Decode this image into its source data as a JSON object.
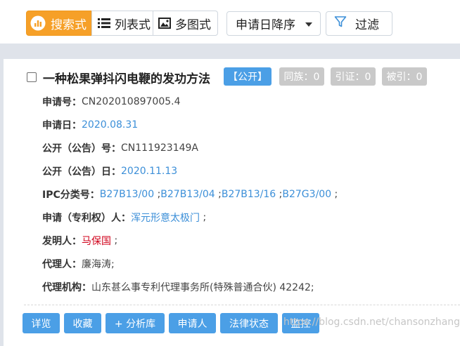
{
  "toolbar": {
    "view_search_label": "搜索式",
    "view_list_label": "列表式",
    "view_multi_label": "多图式",
    "sort_value": "申请日降序",
    "filter_label": "过滤"
  },
  "result": {
    "title": "一种松果弹抖闪电鞭的发功方法",
    "tag_public": "【公开】",
    "tag_family": "同族：0",
    "tag_citation": "引证：0",
    "tag_cited": "被引：0",
    "fields": {
      "app_no_label": "申请号：",
      "app_no": "CN202010897005.4",
      "app_date_label": "申请日：",
      "app_date": "2020.08.31",
      "pub_no_label": "公开（公告）号：",
      "pub_no": "CN111923149A",
      "pub_date_label": "公开（公告）日：",
      "pub_date": "2020.11.13",
      "ipc_label": "IPC分类号：",
      "ipc": [
        "B27B13/00",
        "B27B13/04",
        "B27B13/16",
        "B27G3/00"
      ],
      "applicant_label": "申请（专利权）人：",
      "applicant": "浑元形意太极门",
      "inventor_label": "发明人：",
      "inventor": "马保国",
      "agent_label": "代理人：",
      "agent": "廉海涛;",
      "agency_label": "代理机构：",
      "agency": "山东甚么事专利代理事务所(特殊普通合伙) 42242;"
    },
    "actions": {
      "detail": "详览",
      "favorite": "收藏",
      "add_library": "+ 分析库",
      "applicant": "申请人",
      "legal_status": "法律状态",
      "monitor": "监控"
    },
    "watermark": "https://blog.csdn.net/chansonzhang"
  },
  "colors": {
    "accent": "#f6a028",
    "primary": "#4b9fe6",
    "link": "#3c8fd8",
    "inventor": "#d0021b",
    "tag_grey": "#c9c9c9"
  },
  "icons": {
    "search_view": "search-chart-icon",
    "list_view": "list-icon",
    "multi_view": "image-icon",
    "sort": "caret-down-icon",
    "filter": "funnel-icon"
  }
}
